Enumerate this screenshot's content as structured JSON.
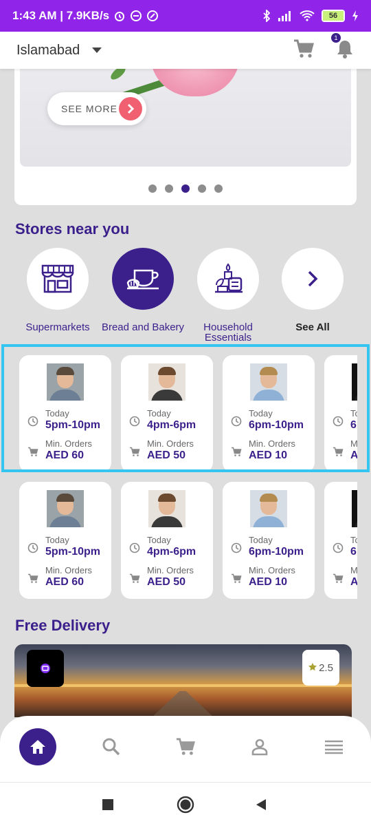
{
  "status_bar": {
    "time_info": "1:43 AM | 7.9KB/s",
    "battery": "56"
  },
  "header": {
    "location": "Islamabad",
    "notification_count": "1"
  },
  "banner": {
    "cta_label": "SEE MORE",
    "dots": 5,
    "active_dot": 2
  },
  "stores_section": {
    "title": "Stores near you",
    "categories": [
      {
        "label": "Supermarkets"
      },
      {
        "label": "Bread and Bakery"
      },
      {
        "label_line1": "Household",
        "label_line2": "Essentials"
      },
      {
        "label": "See All"
      }
    ]
  },
  "stores_row_1": [
    {
      "when": "Today",
      "time": "5pm-10pm",
      "min_label": "Min. Orders",
      "min_value": "AED 60"
    },
    {
      "when": "Today",
      "time": "4pm-6pm",
      "min_label": "Min. Orders",
      "min_value": "AED 50"
    },
    {
      "when": "Today",
      "time": "6pm-10pm",
      "min_label": "Min. Orders",
      "min_value": "AED 10"
    },
    {
      "when": "To",
      "time": "6",
      "min_label": "M",
      "min_value": "A"
    }
  ],
  "stores_row_2": [
    {
      "when": "Today",
      "time": "5pm-10pm",
      "min_label": "Min. Orders",
      "min_value": "AED 60"
    },
    {
      "when": "Today",
      "time": "4pm-6pm",
      "min_label": "Min. Orders",
      "min_value": "AED 50"
    },
    {
      "when": "Today",
      "time": "6pm-10pm",
      "min_label": "Min. Orders",
      "min_value": "AED 10"
    },
    {
      "when": "To",
      "time": "6",
      "min_label": "M",
      "min_value": "A"
    }
  ],
  "free_delivery": {
    "title": "Free Delivery",
    "rating": "2.5"
  },
  "colors": {
    "brand": "#3b1f8b",
    "status_bar": "#9024e8",
    "highlight": "#34c6f0",
    "cta": "#f06070"
  },
  "icons": {
    "bottom_nav": [
      "home-icon",
      "search-icon",
      "cart-icon",
      "account-icon",
      "menu-icon"
    ],
    "system_nav": [
      "recent-apps-icon",
      "home-circle-icon",
      "back-icon"
    ]
  }
}
